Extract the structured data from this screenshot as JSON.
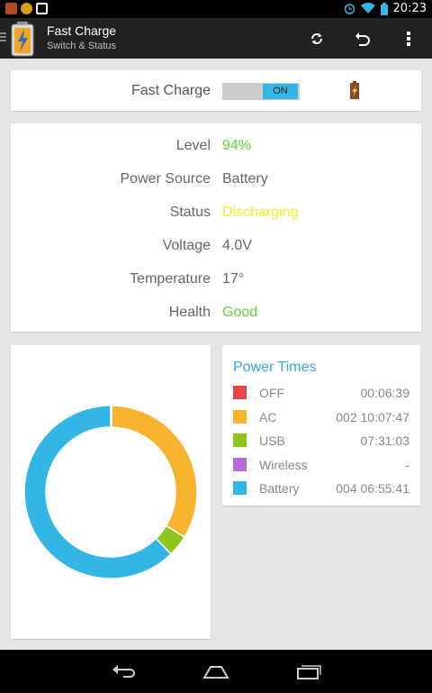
{
  "statusbar": {
    "time": "20:23",
    "icons": [
      "notification-app-icon",
      "notification-app-icon-2",
      "media-icon",
      "alarm-icon",
      "wifi-icon",
      "battery-icon"
    ]
  },
  "actionbar": {
    "title": "Fast Charge",
    "subtitle": "Switch & Status",
    "actions": [
      "refresh-icon",
      "undo-icon",
      "overflow-menu-icon"
    ]
  },
  "fast_charge": {
    "label": "Fast Charge",
    "toggle_state": "ON"
  },
  "status": {
    "rows": [
      {
        "label": "Level",
        "value": "94%",
        "color": "#5bd42e"
      },
      {
        "label": "Power Source",
        "value": "Battery",
        "color": "#666666"
      },
      {
        "label": "Status",
        "value": "Discharging",
        "color": "#f0f02a"
      },
      {
        "label": "Voltage",
        "value": "4.0V",
        "color": "#666666"
      },
      {
        "label": "Temperature",
        "value": "17°",
        "color": "#666666"
      },
      {
        "label": "Health",
        "value": "Good",
        "color": "#5bd42e"
      }
    ]
  },
  "power_times": {
    "title": "Power Times",
    "rows": [
      {
        "name": "OFF",
        "time": "00:06:39",
        "color": "#e84646"
      },
      {
        "name": "AC",
        "time": "002 10:07:47",
        "color": "#f8b32e"
      },
      {
        "name": "USB",
        "time": "07:31:03",
        "color": "#8fc61c"
      },
      {
        "name": "Wireless",
        "time": "-",
        "color": "#b46ad9"
      },
      {
        "name": "Battery",
        "time": "004 06:55:41",
        "color": "#33b5e5"
      }
    ]
  },
  "chart_data": {
    "type": "pie",
    "style": "donut",
    "categories": [
      "OFF",
      "AC",
      "USB",
      "Wireless",
      "Battery"
    ],
    "values": [
      0.2,
      33.5,
      4.0,
      0.0,
      62.3
    ],
    "colors": [
      "#e84646",
      "#f8b32e",
      "#8fc61c",
      "#b46ad9",
      "#33b5e5"
    ]
  },
  "navbar": {
    "buttons": [
      "back-icon",
      "home-icon",
      "recent-apps-icon"
    ]
  }
}
